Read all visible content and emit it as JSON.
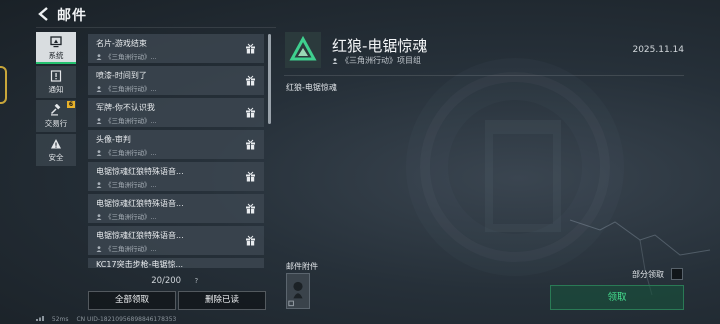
{
  "header": {
    "title": "邮件"
  },
  "nav": [
    {
      "id": "system",
      "label": "系统",
      "icon": "monitor-icon",
      "active": true,
      "badge": ""
    },
    {
      "id": "notice",
      "label": "通知",
      "icon": "notice-icon",
      "active": false,
      "badge": ""
    },
    {
      "id": "trade",
      "label": "交易行",
      "icon": "gavel-icon",
      "active": false,
      "badge": "6"
    },
    {
      "id": "security",
      "label": "安全",
      "icon": "warning-icon",
      "active": false,
      "badge": ""
    }
  ],
  "mail_list": [
    {
      "title": "名片-游戏结束",
      "sender": "《三角洲行动》..."
    },
    {
      "title": "喷漆-时间到了",
      "sender": "《三角洲行动》..."
    },
    {
      "title": "军牌-你不认识我",
      "sender": "《三角洲行动》..."
    },
    {
      "title": "头像-审判",
      "sender": "《三角洲行动》..."
    },
    {
      "title": "电锯惊魂红狼特殊语音...",
      "sender": "《三角洲行动》..."
    },
    {
      "title": "电锯惊魂红狼特殊语音...",
      "sender": "《三角洲行动》..."
    },
    {
      "title": "电锯惊魂红狼特殊语音...",
      "sender": "《三角洲行动》..."
    },
    {
      "title": "KC17突击步枪-电锯惊...",
      "sender": ""
    }
  ],
  "list_footer": {
    "count": "20/200",
    "help": "?",
    "claim_all": "全部领取",
    "delete_read": "删除已读"
  },
  "detail": {
    "title": "红狼-电锯惊魂",
    "sender": "《三角洲行动》项目组",
    "date": "2025.11.14",
    "body": "红狼-电锯惊魂",
    "attachments_label": "邮件附件",
    "partial_claim": "部分领取",
    "claim": "领取"
  },
  "status_bar": {
    "ping": "52ms",
    "uid": "CN UID-18210956898846178353"
  },
  "colors": {
    "accent_green": "#45e08f",
    "badge_yellow": "#e8b22b"
  }
}
